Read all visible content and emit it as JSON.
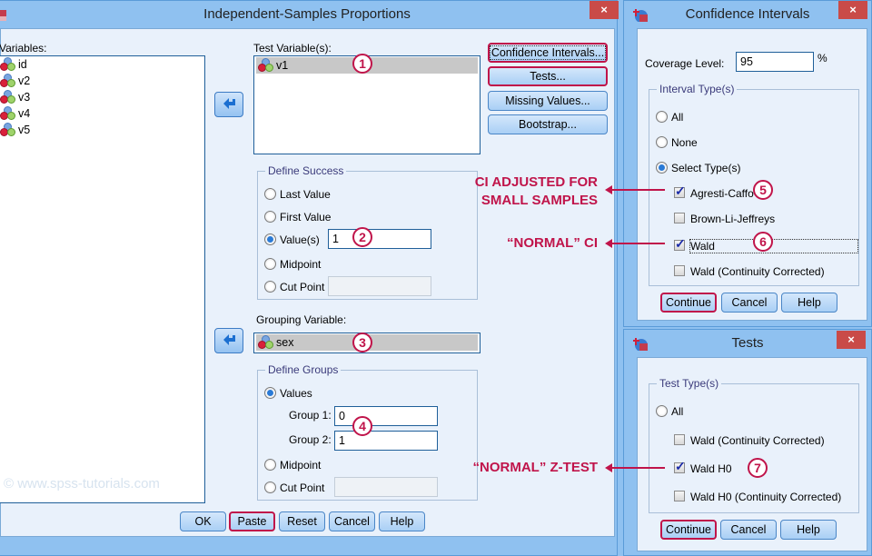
{
  "main_dialog": {
    "title": "Independent-Samples Proportions",
    "close_label": "×",
    "variables_label": "Variables:",
    "variables": [
      "id",
      "v2",
      "v3",
      "v4",
      "v5"
    ],
    "test_variables_label": "Test Variable(s):",
    "test_variables": [
      "v1"
    ],
    "side_buttons": {
      "confidence_intervals": "Confidence Intervals...",
      "tests": "Tests...",
      "missing_values": "Missing Values...",
      "bootstrap": "Bootstrap..."
    },
    "define_success": {
      "title": "Define Success",
      "options": [
        "Last Value",
        "First Value",
        "Value(s)",
        "Midpoint",
        "Cut Point"
      ],
      "selected": "Value(s)",
      "value": "1",
      "cut_point": ""
    },
    "grouping_variable_label": "Grouping Variable:",
    "grouping_variable": "sex",
    "define_groups": {
      "title": "Define Groups",
      "values_label": "Values",
      "group1_label": "Group 1:",
      "group1_value": "0",
      "group2_label": "Group 2:",
      "group2_value": "1",
      "midpoint_label": "Midpoint",
      "cut_point_label": "Cut Point",
      "cut_point": "",
      "selected": "Values"
    },
    "footer_buttons": {
      "ok": "OK",
      "paste": "Paste",
      "reset": "Reset",
      "cancel": "Cancel",
      "help": "Help"
    },
    "watermark": "© www.spss-tutorials.com"
  },
  "ci_dialog": {
    "title": "Confidence Intervals",
    "close_label": "×",
    "coverage_label": "Coverage Level:",
    "coverage_value": "95",
    "percent_sign": "%",
    "interval_type_title": "Interval Type(s)",
    "radios": [
      "All",
      "None",
      "Select Type(s)"
    ],
    "selected_radio": "Select Type(s)",
    "checks": [
      {
        "label": "Agresti-Caffo",
        "checked": true
      },
      {
        "label": "Brown-Li-Jeffreys",
        "checked": false
      },
      {
        "label": "Wald",
        "checked": true
      },
      {
        "label": "Wald (Continuity Corrected)",
        "checked": false
      }
    ],
    "buttons": {
      "continue": "Continue",
      "cancel": "Cancel",
      "help": "Help"
    }
  },
  "tests_dialog": {
    "title": "Tests",
    "close_label": "×",
    "test_type_title": "Test Type(s)",
    "all_label": "All",
    "checks": [
      {
        "label": "Wald (Continuity Corrected)",
        "checked": false
      },
      {
        "label": "Wald H0",
        "checked": true
      },
      {
        "label": "Wald H0 (Continuity Corrected)",
        "checked": false
      }
    ],
    "buttons": {
      "continue": "Continue",
      "cancel": "Cancel",
      "help": "Help"
    }
  },
  "annotations": {
    "badges": [
      "1",
      "2",
      "3",
      "4",
      "5",
      "6",
      "7"
    ],
    "ci_small_line1": "CI ADJUSTED FOR",
    "ci_small_line2": "SMALL SAMPLES",
    "normal_ci": "“NORMAL” CI",
    "normal_ztest": "“NORMAL” Z-TEST",
    "accent_color": "#c0144a"
  }
}
